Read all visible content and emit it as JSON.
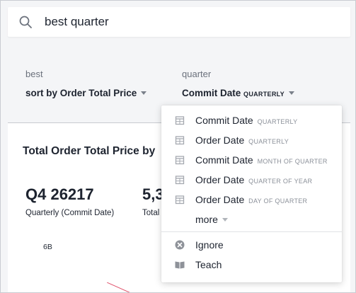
{
  "search": {
    "query": "best quarter",
    "placeholder": ""
  },
  "tokens": [
    {
      "word": "best",
      "value": "sort by Order Total Price",
      "sub": ""
    },
    {
      "word": "quarter",
      "value": "Commit Date",
      "sub": "QUARTERLY"
    }
  ],
  "card": {
    "title": "Total Order Total Price by",
    "kpis": [
      {
        "value": "Q4 26217",
        "label": "Quarterly (Commit Date)"
      },
      {
        "value": "5,3",
        "label": "Total"
      }
    ],
    "y_tick": "6B"
  },
  "dropdown": {
    "options": [
      {
        "label": "Commit Date",
        "sub": "QUARTERLY",
        "icon": "calendar-icon"
      },
      {
        "label": "Order Date",
        "sub": "QUARTERLY",
        "icon": "calendar-icon"
      },
      {
        "label": "Commit Date",
        "sub": "MONTH OF QUARTER",
        "icon": "calendar-icon"
      },
      {
        "label": "Order Date",
        "sub": "QUARTER OF YEAR",
        "icon": "calendar-icon"
      },
      {
        "label": "Order Date",
        "sub": "DAY OF QUARTER",
        "icon": "calendar-icon"
      }
    ],
    "more_label": "more",
    "actions": [
      {
        "label": "Ignore",
        "icon": "ignore-icon"
      },
      {
        "label": "Teach",
        "icon": "book-icon"
      }
    ]
  },
  "colors": {
    "accent_line": "#e0506a",
    "icon_gray": "#a5a9b0",
    "text_dark": "#1d232f"
  }
}
